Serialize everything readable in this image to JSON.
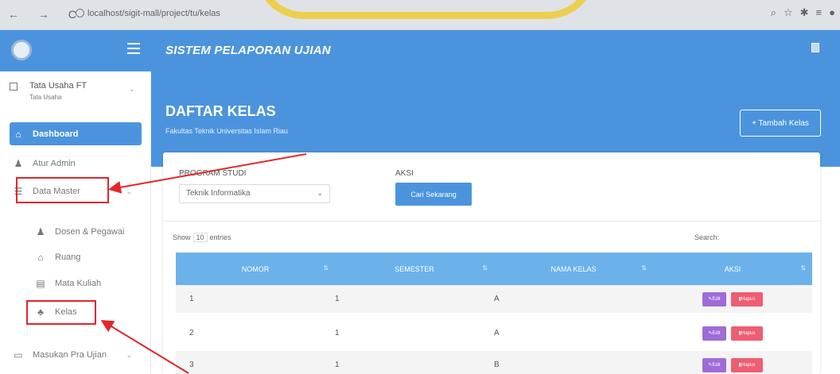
{
  "browser": {
    "url": "localhost/sigit-mall/project/tu/kelas",
    "nav_icons": [
      "back-arrow",
      "forward-arrow",
      "reload"
    ],
    "right_icons": [
      "zoom",
      "star",
      "extensions",
      "profile"
    ]
  },
  "app": {
    "title": "SISTEM PELAPORAN UJIAN"
  },
  "user": {
    "name": "Tata Usaha FT",
    "role": "Tata Usaha"
  },
  "sidebar": {
    "items": [
      {
        "label": "Dashboard",
        "icon": "home-icon",
        "active": true
      },
      {
        "label": "Atur Admin",
        "icon": "user-icon"
      },
      {
        "label": "Data Master",
        "icon": "database-icon",
        "expandable": true
      },
      {
        "label": "Dosen & Pegawai",
        "icon": "user-icon"
      },
      {
        "label": "Ruang",
        "icon": "building-icon"
      },
      {
        "label": "Mata Kuliah",
        "icon": "book-icon"
      },
      {
        "label": "Kelas",
        "icon": "users-icon"
      },
      {
        "label": "Masukan Pra Ujian",
        "icon": "calendar-icon",
        "expandable": true
      }
    ]
  },
  "header": {
    "title": "DAFTAR KELAS",
    "subtitle": "Fakultas Teknik Universitas Islam Riau",
    "add_button": "+ Tambah Kelas"
  },
  "filter": {
    "program_label": "PROGRAM STUDI",
    "program_value": "Teknik Informatika",
    "aksi_label": "AKSI",
    "search_button": "Cari Sekarang"
  },
  "table": {
    "show_prefix": "Show",
    "show_value": "10",
    "show_suffix": "entries",
    "search_label": "Search:",
    "columns": [
      "NOMOR",
      "SEMESTER",
      "NAMA KELAS",
      "AKSI"
    ],
    "rows": [
      {
        "nomor": "1",
        "semester": "1",
        "nama": "A"
      },
      {
        "nomor": "2",
        "semester": "1",
        "nama": "A"
      },
      {
        "nomor": "3",
        "semester": "1",
        "nama": "B"
      }
    ],
    "edit_label": "Edit",
    "hapus_label": "Hapus"
  },
  "colors": {
    "primary": "#4b94dd",
    "table_header": "#6cb2ea",
    "highlight": "#e2262c",
    "edit": "#9f6bd8",
    "delete": "#ef5d73"
  }
}
